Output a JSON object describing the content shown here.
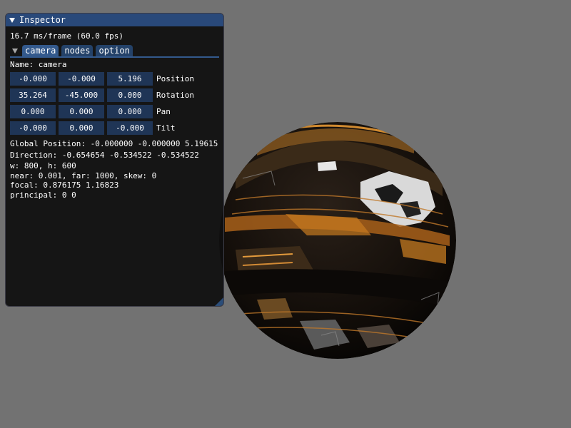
{
  "inspector": {
    "title": "Inspector",
    "fps": "16.7 ms/frame (60.0 fps)",
    "tabs": [
      {
        "label": "camera",
        "active": true
      },
      {
        "label": "nodes",
        "active": false
      },
      {
        "label": "option",
        "active": false
      }
    ],
    "name": "Name: camera",
    "rows": [
      {
        "label": "Position",
        "values": [
          "-0.000",
          "-0.000",
          "5.196"
        ]
      },
      {
        "label": "Rotation",
        "values": [
          "35.264",
          "-45.000",
          "0.000"
        ]
      },
      {
        "label": "Pan",
        "values": [
          "0.000",
          "0.000",
          "0.000"
        ]
      },
      {
        "label": "Tilt",
        "values": [
          "-0.000",
          "0.000",
          "-0.000"
        ]
      }
    ],
    "global_position": "Global Position: -0.000000 -0.000000 5.19615",
    "direction": "Direction: -0.654654 -0.534522 -0.534522",
    "size": "w: 800, h: 600",
    "clip": "near: 0.001, far: 1000, skew: 0",
    "focal": "focal: 0.876175  1.16823",
    "principal": "principal: 0 0"
  },
  "colors": {
    "background": "#727272",
    "title_bar": "#29497a",
    "tab_active": "#33598c",
    "field_bg": "#1f3556"
  },
  "icons": {
    "window_collapse": "triangle-down-icon",
    "tab_collapse": "triangle-down-icon"
  }
}
